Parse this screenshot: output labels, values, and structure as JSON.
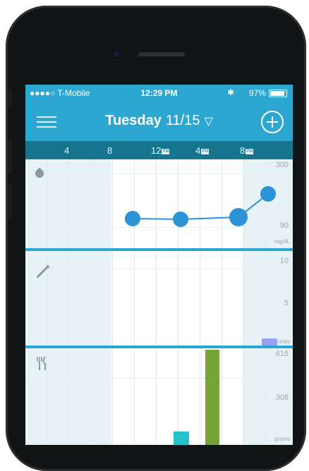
{
  "status_bar": {
    "carrier": "●●●●○ T-Mobile",
    "time": "12:29 PM",
    "bluetooth": "✱",
    "battery": "97%"
  },
  "header": {
    "day": "Tuesday",
    "date": "11/15",
    "dropdown_glyph": "▽",
    "menu_icon": "hamburger-menu-icon",
    "add_icon": "plus-circle-icon"
  },
  "time_axis": {
    "ticks": [
      {
        "label": "4",
        "pm": ""
      },
      {
        "label": "8",
        "pm": ""
      },
      {
        "label": "12",
        "pm": "PM"
      },
      {
        "label": "4",
        "pm": "PM"
      },
      {
        "label": "8",
        "pm": "PM"
      }
    ]
  },
  "glucose": {
    "icon": "blood-drop-icon",
    "axis_top": "300",
    "axis_bottom": "90",
    "unit": "mg/dL",
    "color": "#2b93d6"
  },
  "insulin": {
    "icon": "syringe-icon",
    "axis_top": "10",
    "axis_mid": "5",
    "unit": "units"
  },
  "carbs": {
    "icon": "fork-knife-icon",
    "axis_top": "615",
    "axis_mid": "308",
    "unit": "grams"
  },
  "colors": {
    "header": "#2ba7d1",
    "time_axis": "#17748f",
    "night_shade": "#e7f2f7",
    "insulin_bar": "#9aa0f0",
    "carb_bar_green": "#74a33a",
    "carb_bar_teal": "#24c2c9"
  }
}
